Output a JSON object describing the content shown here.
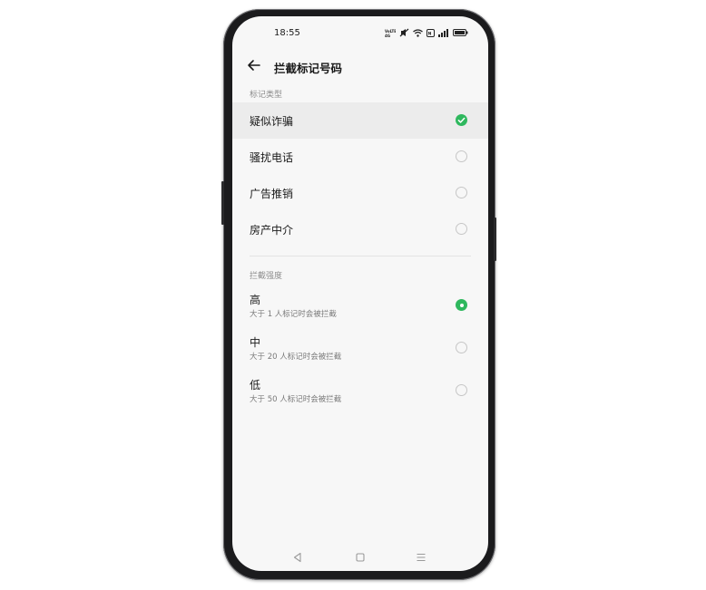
{
  "status_bar": {
    "time": "18:55",
    "icons": [
      "volte-icon",
      "mute-icon",
      "wifi-icon",
      "nfc-icon",
      "signal-icon",
      "battery-icon"
    ]
  },
  "header": {
    "title": "拦截标记号码",
    "back_icon": "back-arrow-icon"
  },
  "mark_type": {
    "section_label": "标记类型",
    "options": [
      {
        "label": "疑似诈骗",
        "selected": true
      },
      {
        "label": "骚扰电话",
        "selected": false
      },
      {
        "label": "广告推销",
        "selected": false
      },
      {
        "label": "房产中介",
        "selected": false
      }
    ]
  },
  "intensity": {
    "section_label": "拦截强度",
    "options": [
      {
        "label": "高",
        "description": "大于 1 人标记时会被拦截",
        "selected": true
      },
      {
        "label": "中",
        "description": "大于 20 人标记时会被拦截",
        "selected": false
      },
      {
        "label": "低",
        "description": "大于 50 人标记时会被拦截",
        "selected": false
      }
    ]
  },
  "nav_bar": {
    "buttons": [
      "back-triangle-icon",
      "home-square-icon",
      "menu-lines-icon"
    ]
  },
  "colors": {
    "accent": "#2fb85e",
    "screen_bg": "#f7f7f7",
    "selected_row_bg": "#ececec",
    "frame": "#1b1b1d"
  }
}
